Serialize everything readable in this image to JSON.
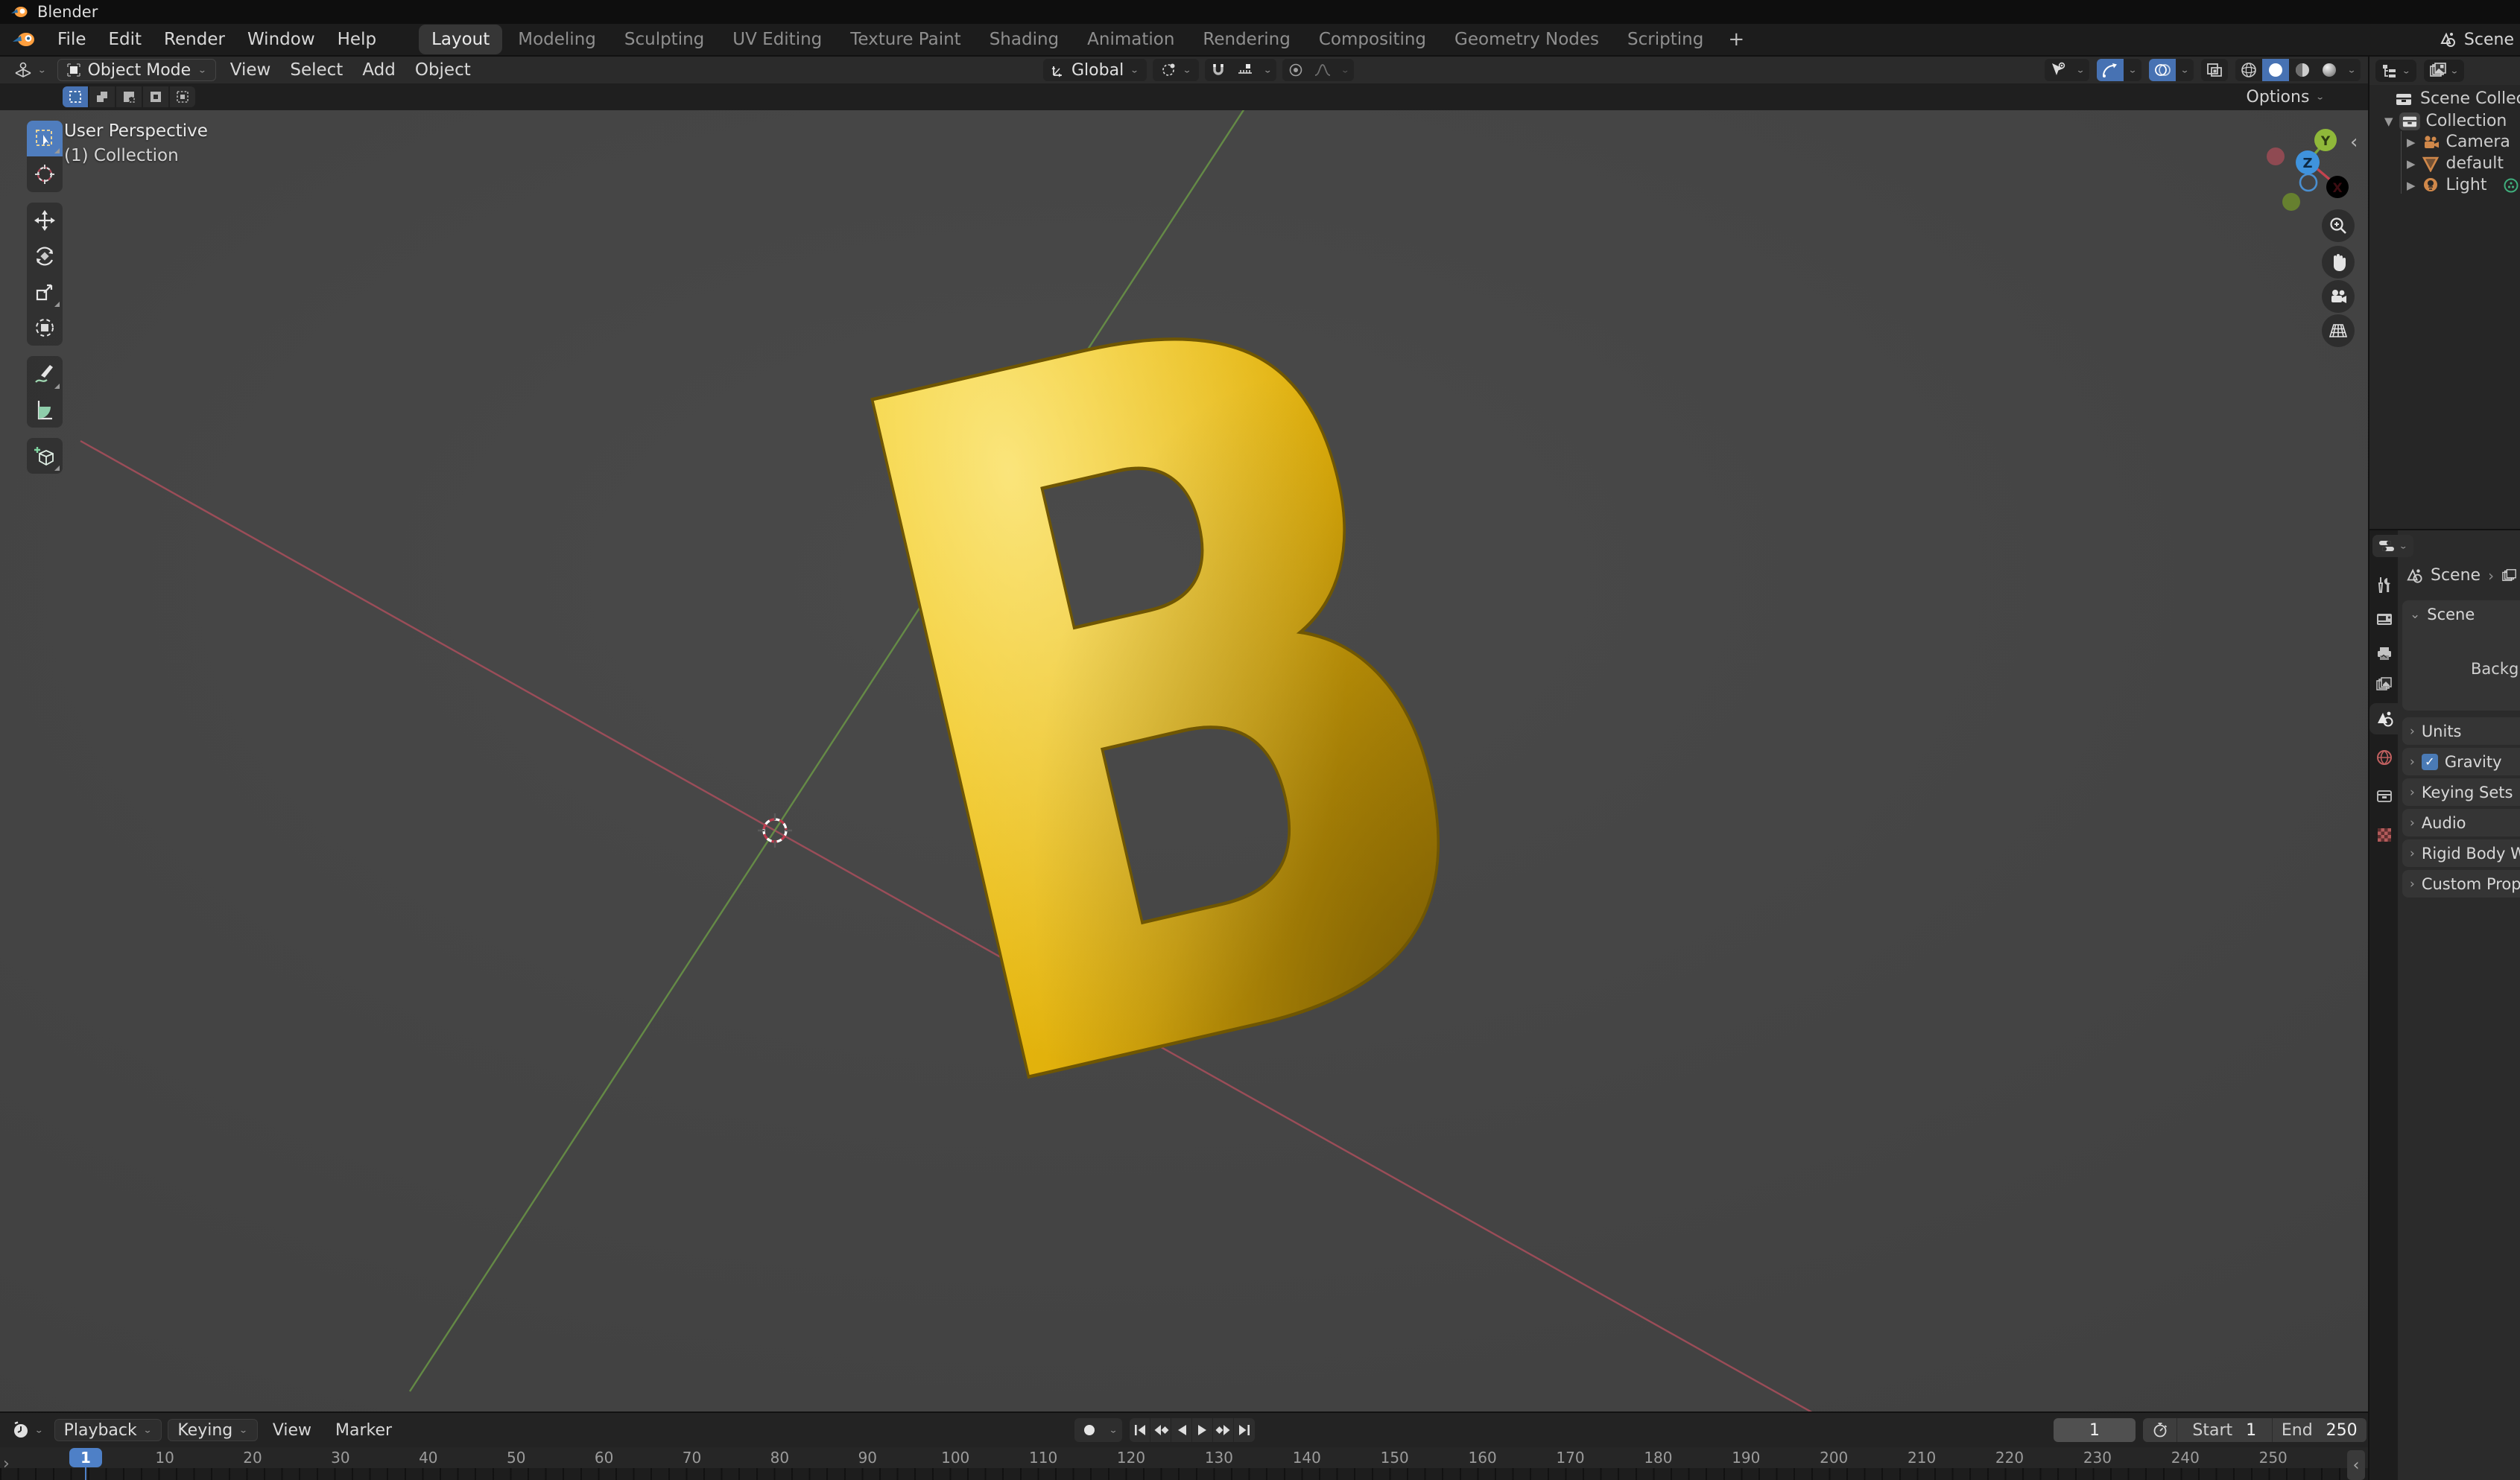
{
  "window": {
    "title": "Blender"
  },
  "topbar": {
    "app_menus": [
      "File",
      "Edit",
      "Render",
      "Window",
      "Help"
    ],
    "workspace_tabs": [
      "Layout",
      "Modeling",
      "Sculpting",
      "UV Editing",
      "Texture Paint",
      "Shading",
      "Animation",
      "Rendering",
      "Compositing",
      "Geometry Nodes",
      "Scripting"
    ],
    "active_tab": "Layout",
    "new_workspace_label": "+",
    "scene_selector": {
      "label": "Scene"
    }
  },
  "viewport_header": {
    "mode_selector": "Object Mode",
    "menus": [
      "View",
      "Select",
      "Add",
      "Object"
    ],
    "transform_orientation": "Global",
    "shading_modes": [
      "wireframe",
      "solid",
      "material-preview",
      "rendered"
    ],
    "active_shading": "solid"
  },
  "tool_settings": {
    "options_label": "Options"
  },
  "viewport": {
    "overlay": {
      "perspective": "User Perspective",
      "collection": "(1) Collection"
    },
    "axis_labels": {
      "x": "X",
      "y": "Y",
      "z": "Z"
    }
  },
  "toolbar_tools": [
    "select-box",
    "cursor",
    "move",
    "rotate",
    "scale",
    "transform",
    "annotate",
    "measure",
    "add-cube"
  ],
  "outliner": {
    "root_label": "Scene Collection",
    "collection_label": "Collection",
    "items": [
      {
        "label": "Camera",
        "icon": "camera"
      },
      {
        "label": "default",
        "icon": "mesh"
      },
      {
        "label": "Light",
        "icon": "light"
      }
    ]
  },
  "properties": {
    "breadcrumb": {
      "scene": "Scene"
    },
    "scene_panel_field_label": "Background",
    "panels": [
      {
        "label": "Scene",
        "expanded": true
      },
      {
        "label": "Units"
      },
      {
        "label": "Gravity",
        "checkbox": true
      },
      {
        "label": "Keying Sets"
      },
      {
        "label": "Audio"
      },
      {
        "label": "Rigid Body World"
      },
      {
        "label": "Custom Properties"
      }
    ]
  },
  "timeline": {
    "menus": [
      "Playback",
      "Keying",
      "View",
      "Marker"
    ],
    "dropdown_menus": [
      "Playback",
      "Keying"
    ],
    "current_frame": "1",
    "frame_field_value": "1",
    "start_label": "Start",
    "start_value": "1",
    "end_label": "End",
    "end_value": "250",
    "ruler": {
      "tick_start": 10,
      "tick_step": 10,
      "tick_end": 250
    }
  },
  "colors": {
    "accent_blue": "#4772b3",
    "balloon_gold": "#e7b80d",
    "axis_red": "#bc4f63",
    "axis_green": "#6fa146",
    "outliner_orange": "#d0884a"
  }
}
